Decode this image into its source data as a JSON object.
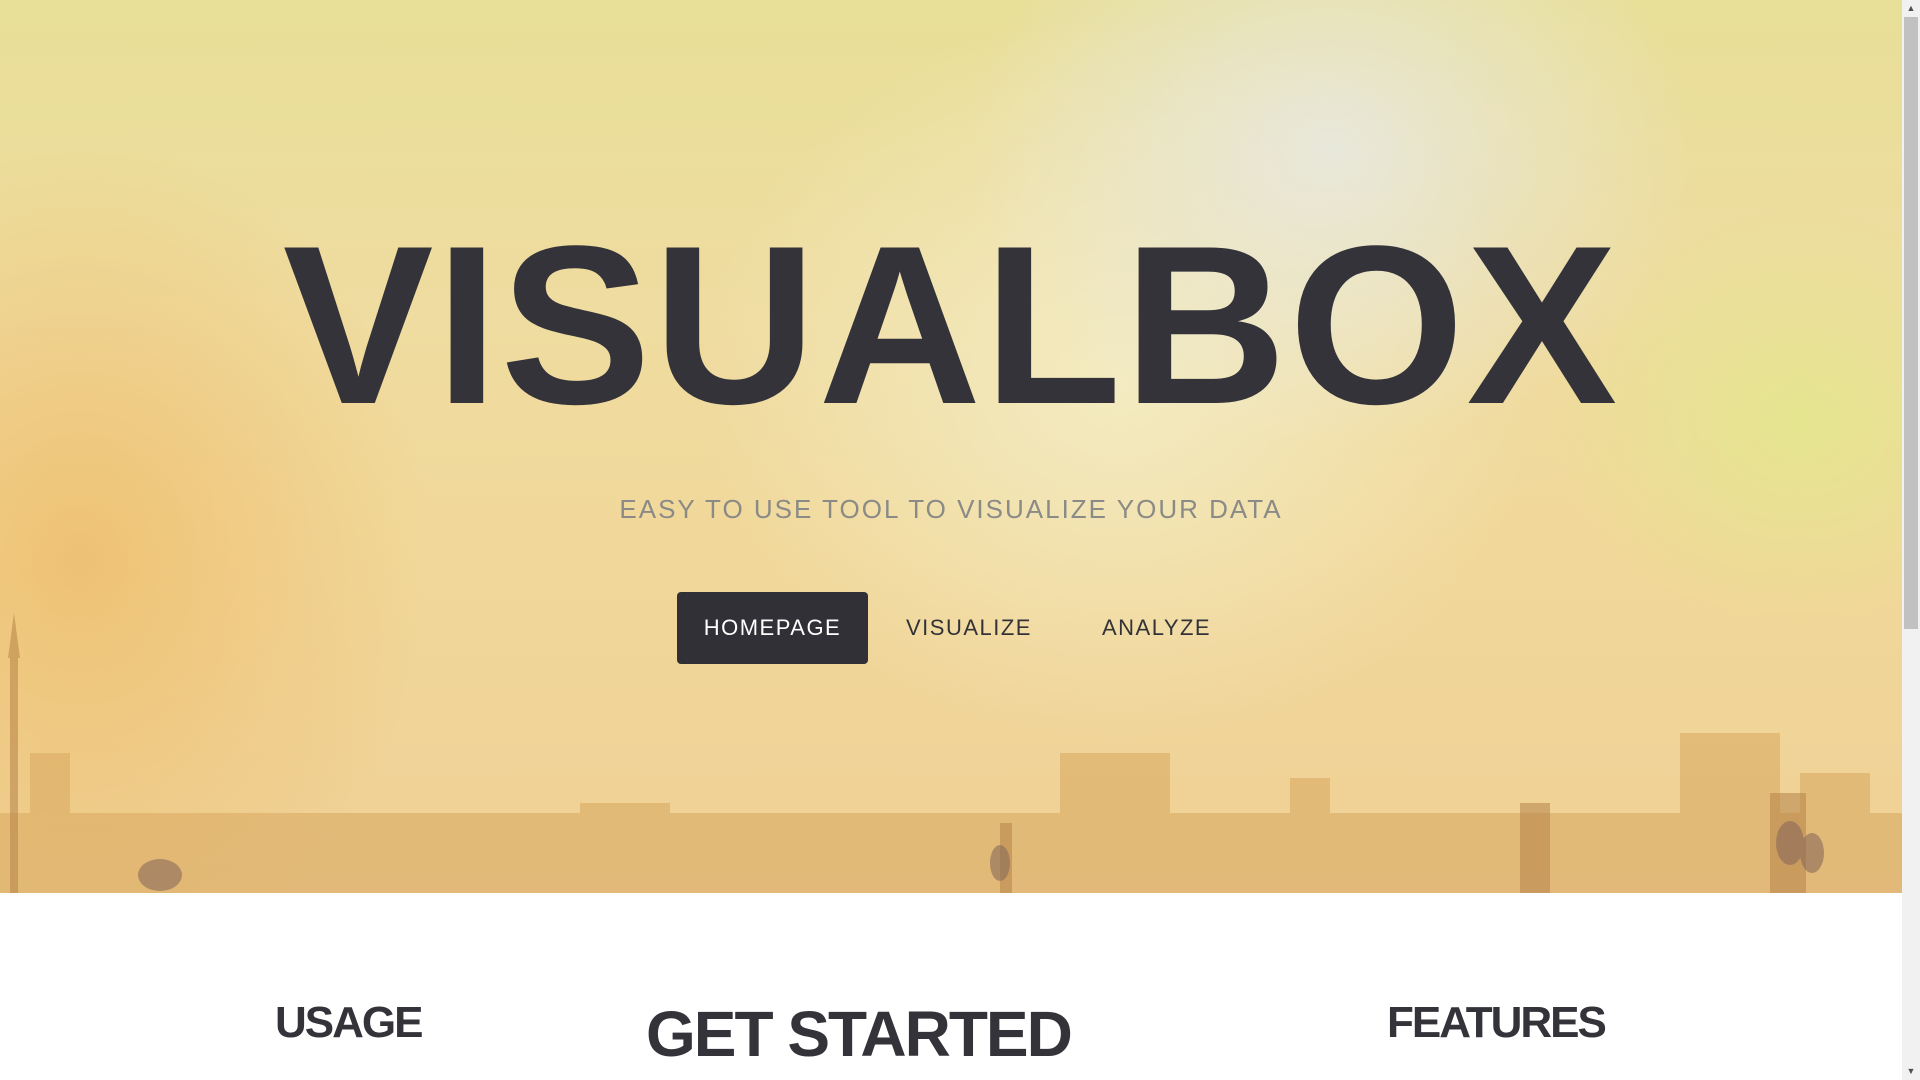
{
  "hero": {
    "title": "VISUALBOX",
    "subtitle": "EASY TO USE TOOL TO VISUALIZE YOUR DATA",
    "nav": {
      "homepage": "HOMEPAGE",
      "visualize": "VISUALIZE",
      "analyze": "ANALYZE",
      "active": "HOMEPAGE"
    }
  },
  "sections": {
    "usage": "USAGE",
    "get_started": "GET STARTED",
    "features": "FEATURES"
  },
  "scrollbar": {
    "up_arrow": "▲",
    "down_arrow": "▼"
  },
  "colors": {
    "dark": "#34333a",
    "button_active_bg": "#303036",
    "subtitle": "#8a8a86",
    "hero_warm": "#efd096",
    "hero_light": "#e8e8de"
  }
}
